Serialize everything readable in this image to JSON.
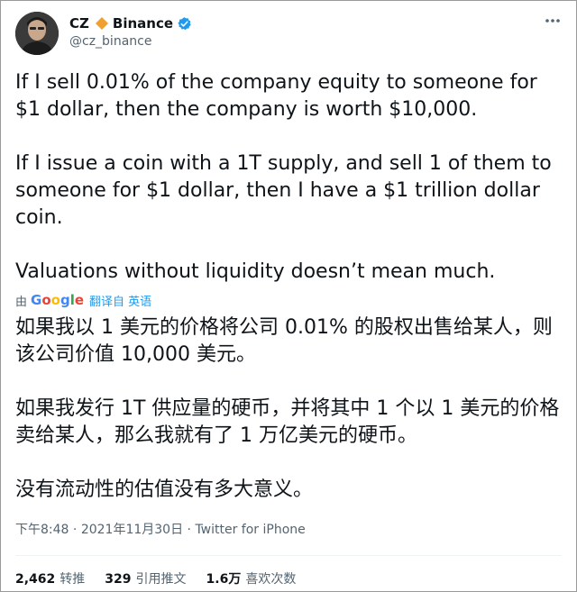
{
  "author": {
    "name": "CZ",
    "affiliation": "Binance",
    "handle": "@cz_binance",
    "verified_color": "#1d9bf0",
    "diamond_color": "#f0a030",
    "diamond_icon": "orange-diamond-icon",
    "verified_icon": "verified-badge-icon"
  },
  "tweet": {
    "paragraph1": "If I sell 0.01% of the company equity to someone for $1 dollar, then the company is worth $10,000.",
    "paragraph2": "If I issue a coin with a 1T supply, and sell 1 of them to someone for $1 dollar, then I have a $1 trillion dollar coin.",
    "paragraph3": "Valuations without liquidity doesn’t mean much."
  },
  "translation": {
    "by": "由",
    "provider": "Google",
    "label": "翻译自 英语",
    "paragraph1": "如果我以 1 美元的价格将公司 0.01% 的股权出售给某人，则该公司价值 10,000 美元。",
    "paragraph2": "如果我发行 1T 供应量的硬币，并将其中 1 个以 1 美元的价格卖给某人，那么我就有了 1 万亿美元的硬币。",
    "paragraph3": "没有流动性的估值没有多大意义。"
  },
  "meta": {
    "time": "下午8:48",
    "sep1": " · ",
    "date": "2021年11月30日",
    "sep2": " · ",
    "source": "Twitter for iPhone"
  },
  "stats": {
    "retweets_count": "2,462",
    "retweets_label": "转推",
    "quotes_count": "329",
    "quotes_label": "引用推文",
    "likes_count": "1.6万",
    "likes_label": "喜欢次数"
  }
}
